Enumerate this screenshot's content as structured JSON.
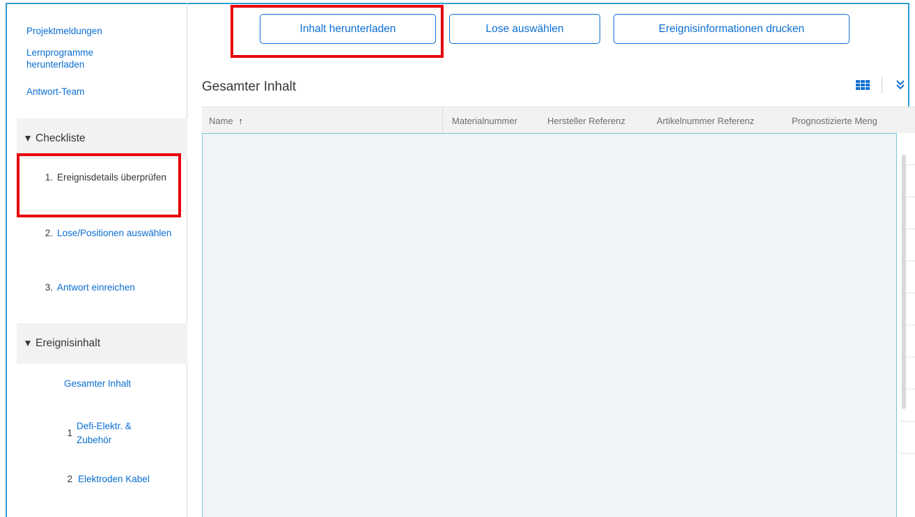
{
  "sidebar": {
    "links": [
      "Projektmeldungen",
      "Lernprogramme herunterladen",
      "Antwort-Team"
    ],
    "checklist": {
      "title": "Checkliste",
      "steps": [
        {
          "num": "1.",
          "label": "Ereignisdetails überprüfen"
        },
        {
          "num": "2.",
          "label": "Lose/Positionen auswählen"
        },
        {
          "num": "3.",
          "label": "Antwort einreichen"
        }
      ]
    },
    "event_content": {
      "title": "Ereignisinhalt",
      "all_label": "Gesamter Inhalt",
      "items": [
        {
          "num": "1",
          "label": "Defi-Elektr. & Zubehör"
        },
        {
          "num": "2",
          "label": "Elektroden Kabel"
        }
      ]
    }
  },
  "toolbar": {
    "download_label": "Inhalt herunterladen",
    "select_lots_label": "Lose auswählen",
    "print_label": "Ereignisinformationen drucken"
  },
  "main": {
    "title": "Gesamter Inhalt",
    "columns": [
      "Name",
      "Materialnummer",
      "Hersteller Referenz",
      "Artikelnummer Referenz",
      "Prognostizierte Meng"
    ],
    "sort_indicator": "↑"
  },
  "icons": [
    "grid-view-icon",
    "expand-icon",
    "caret-down-icon",
    "sort-ascending-icon"
  ],
  "colors": {
    "accent": "#0a6ed1",
    "highlight": "#e8000b",
    "frame": "#2b9fd6"
  }
}
